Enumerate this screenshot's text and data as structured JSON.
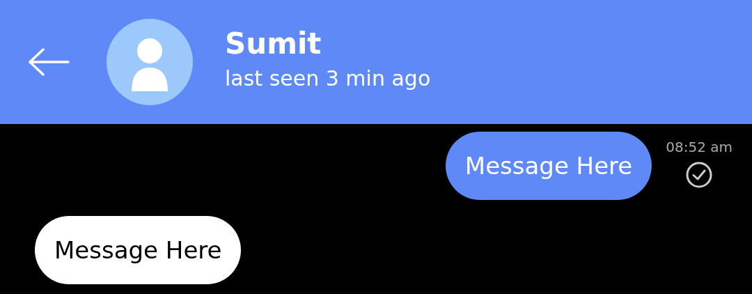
{
  "header": {
    "name": "Sumit",
    "status": "last seen 3 min ago"
  },
  "messages": [
    {
      "kind": "sent",
      "text": "Message Here",
      "time": "08:52 am",
      "read": true
    },
    {
      "kind": "received",
      "text": "Message Here"
    }
  ]
}
